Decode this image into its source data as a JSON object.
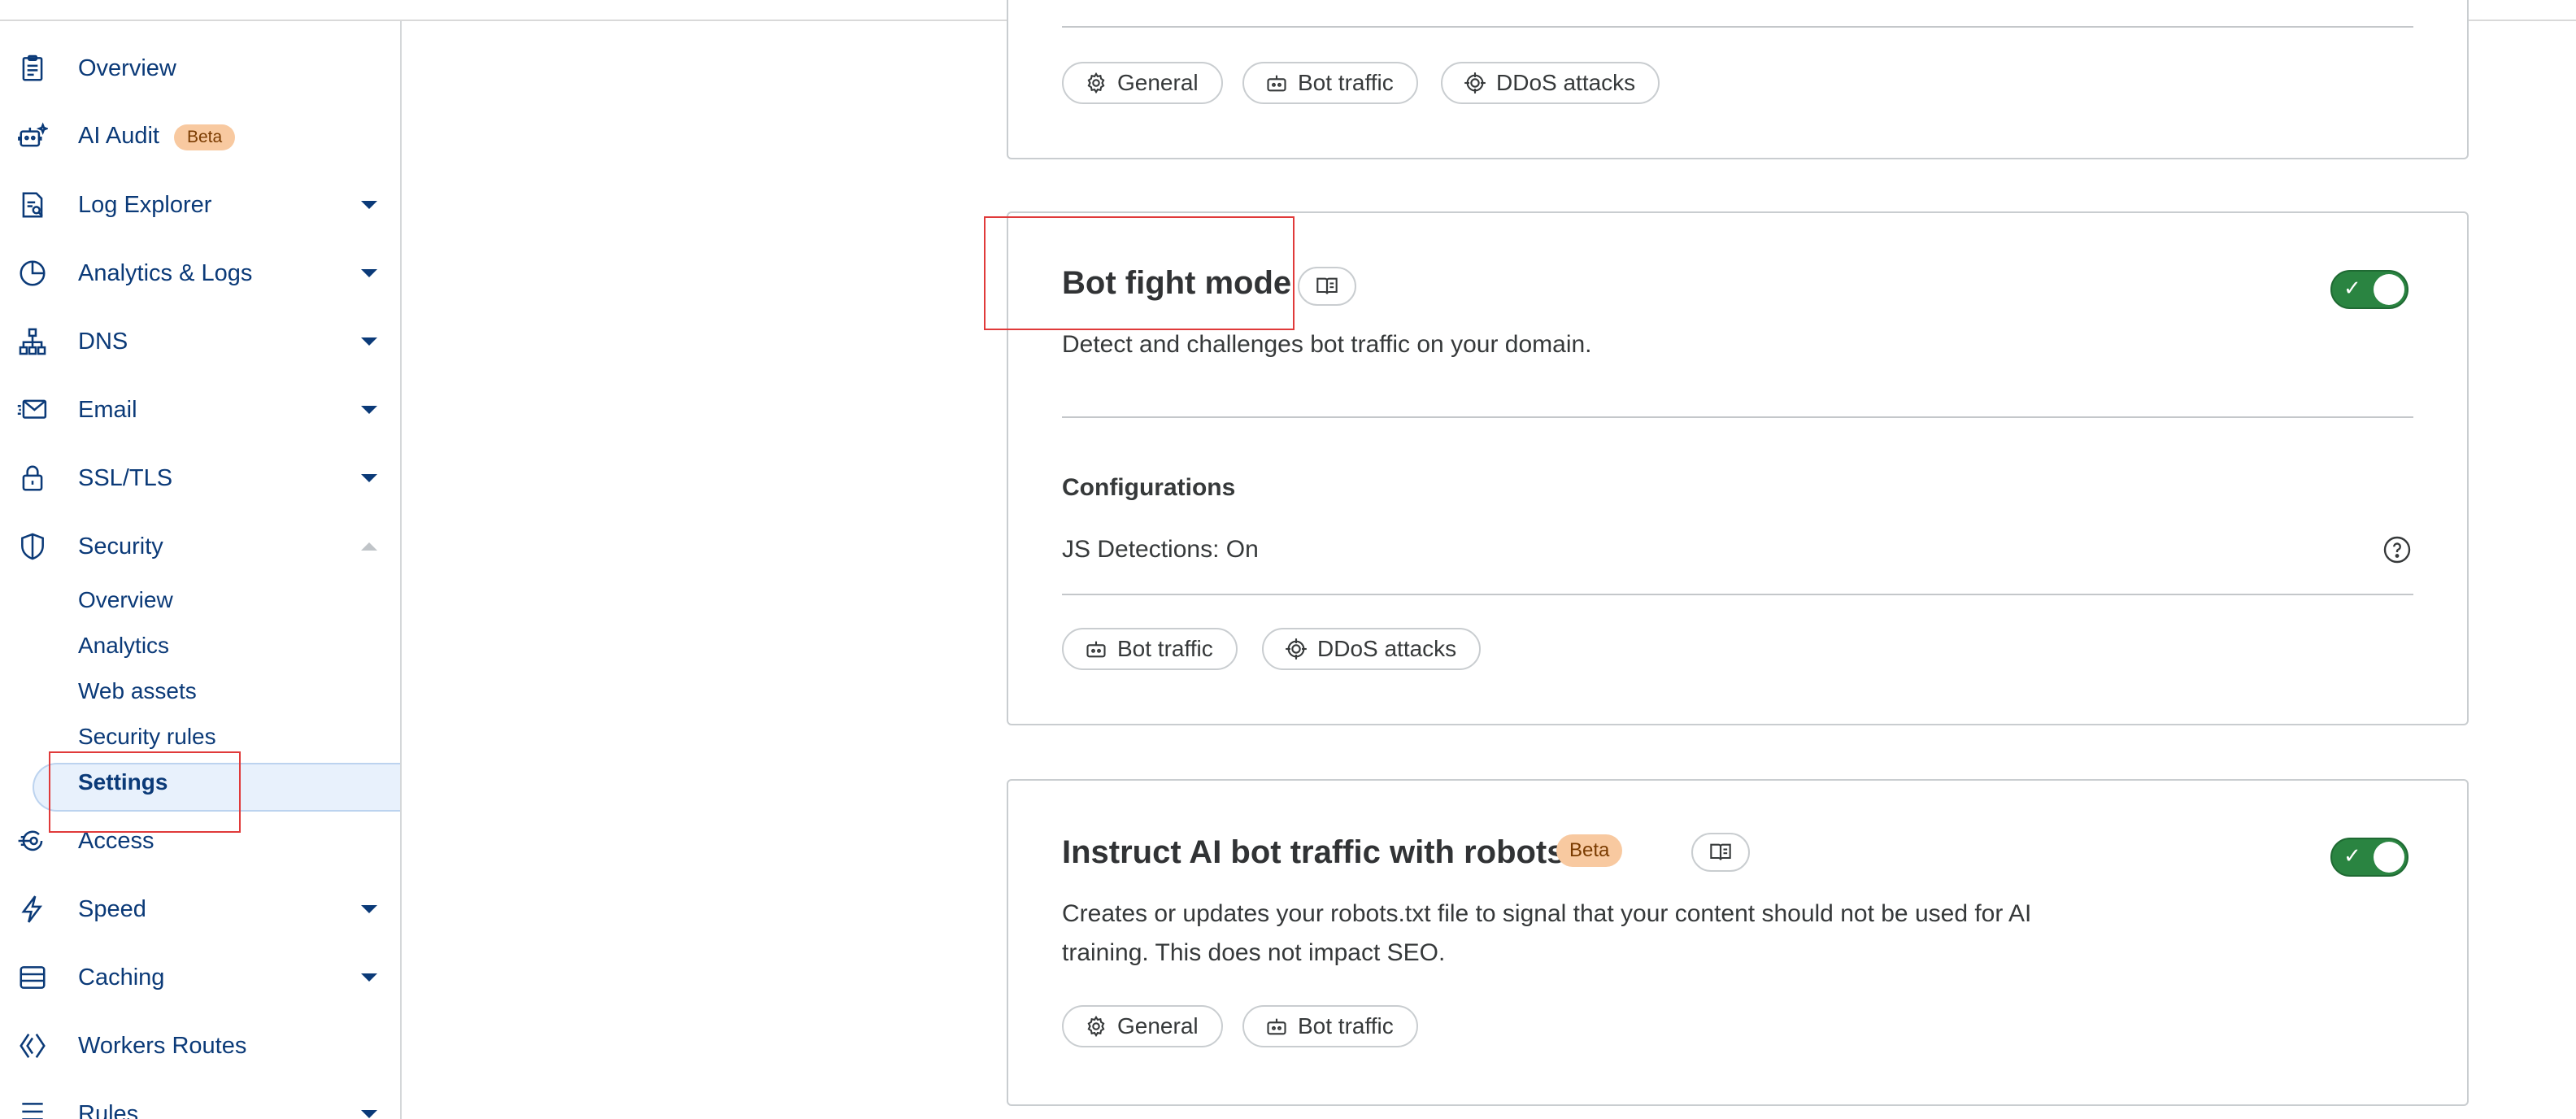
{
  "sidebar": {
    "items": [
      {
        "label": "Overview",
        "icon": "clipboard-icon"
      },
      {
        "label": "AI Audit",
        "badge": "Beta",
        "icon": "robot-sparkle-icon"
      },
      {
        "label": "Log Explorer",
        "icon": "log-explorer-icon"
      },
      {
        "label": "Analytics & Logs",
        "icon": "pie-chart-icon"
      },
      {
        "label": "DNS",
        "icon": "network-icon"
      },
      {
        "label": "Email",
        "icon": "envelope-icon"
      },
      {
        "label": "SSL/TLS",
        "icon": "lock-icon"
      },
      {
        "label": "Security",
        "icon": "shield-icon"
      },
      {
        "label": "Access",
        "icon": "access-icon"
      },
      {
        "label": "Speed",
        "icon": "lightning-icon"
      },
      {
        "label": "Caching",
        "icon": "caching-icon"
      },
      {
        "label": "Workers Routes",
        "icon": "workers-icon"
      },
      {
        "label": "Rules",
        "icon": "rules-icon"
      }
    ],
    "security_sub": [
      "Overview",
      "Analytics",
      "Web assets",
      "Security rules",
      "Settings"
    ],
    "active_sub": "Settings"
  },
  "cards": {
    "top": {
      "tags": [
        "General",
        "Bot traffic",
        "DDoS attacks"
      ]
    },
    "bot_fight": {
      "title": "Bot fight mode",
      "description": "Detect and challenges bot traffic on your domain.",
      "config_heading": "Configurations",
      "config_line": "JS Detections: On",
      "tags": [
        "Bot traffic",
        "DDoS attacks"
      ],
      "enabled": true
    },
    "ai_robots": {
      "title": "Instruct AI bot traffic with robots.txt",
      "badge": "Beta",
      "description_line1": "Creates or updates your robots.txt file to signal that your content should not be used for AI",
      "description_line2": "training. This does not impact SEO.",
      "tags": [
        "General",
        "Bot traffic"
      ],
      "enabled": true
    }
  },
  "colors": {
    "nav_text": "#0b3a78",
    "toggle_on": "#2a8441",
    "beta_bg": "#f8c9a0",
    "highlight_box": "#e03a3a"
  }
}
